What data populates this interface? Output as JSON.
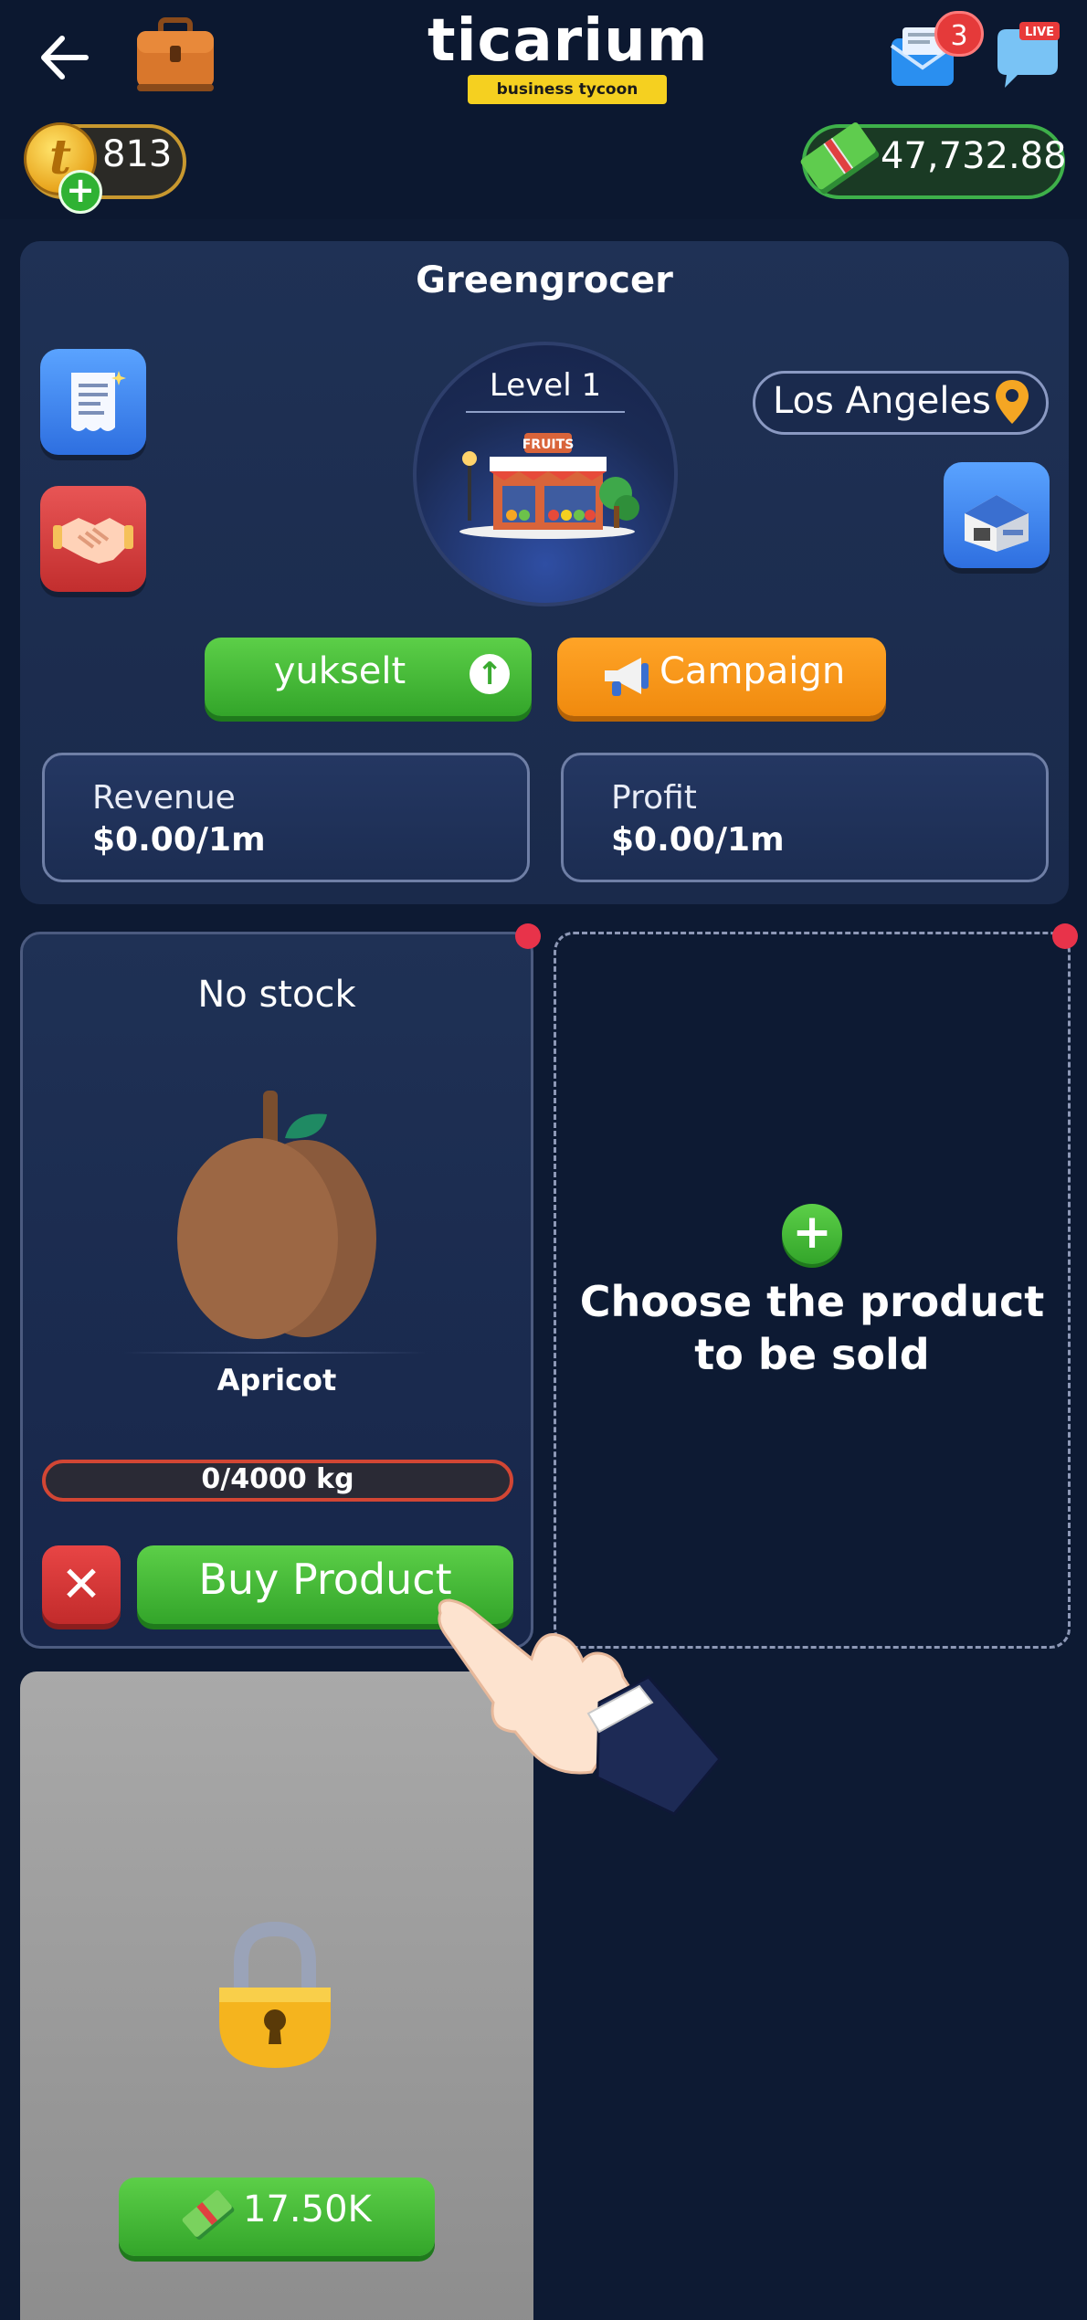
{
  "header": {
    "logo_text": "ticarium",
    "logo_subtitle": "business tycoon",
    "mail_badge": "3",
    "live_label": "LIVE",
    "coins": "813",
    "money": "47,732.88"
  },
  "shop": {
    "title": "Greengrocer",
    "level": "Level 1",
    "sign_text": "FRUITS",
    "city": "Los Angeles",
    "upgrade_label": "yukselt",
    "campaign_label": "Campaign",
    "revenue_label": "Revenue",
    "revenue_value": "$0.00/1m",
    "profit_label": "Profit",
    "profit_value": "$0.00/1m"
  },
  "product_slot": {
    "status": "No stock",
    "product_name": "Apricot",
    "stock": "0/4000 kg",
    "stock_fraction": 0,
    "cancel_symbol": "✕",
    "buy_label": "Buy Product"
  },
  "empty_slot": {
    "plus_symbol": "+",
    "prompt_line1": "Choose the product",
    "prompt_line2": "to be sold"
  },
  "locked_slot": {
    "unlock_price": "17.50K"
  },
  "colors": {
    "background": "#0d1a33",
    "card": "#1f3155",
    "green": "#3aaa30",
    "orange": "#f59a1a",
    "red": "#e8334a"
  },
  "icons": [
    "back-arrow-icon",
    "briefcase-icon",
    "mail-icon",
    "live-chat-icon",
    "coin-icon",
    "cash-icon",
    "receipt-icon",
    "handshake-icon",
    "store-icon",
    "location-pin-icon",
    "arrow-up-icon",
    "megaphone-icon",
    "apricot-icon",
    "close-icon",
    "plus-icon",
    "pointing-hand-icon",
    "lock-icon"
  ]
}
